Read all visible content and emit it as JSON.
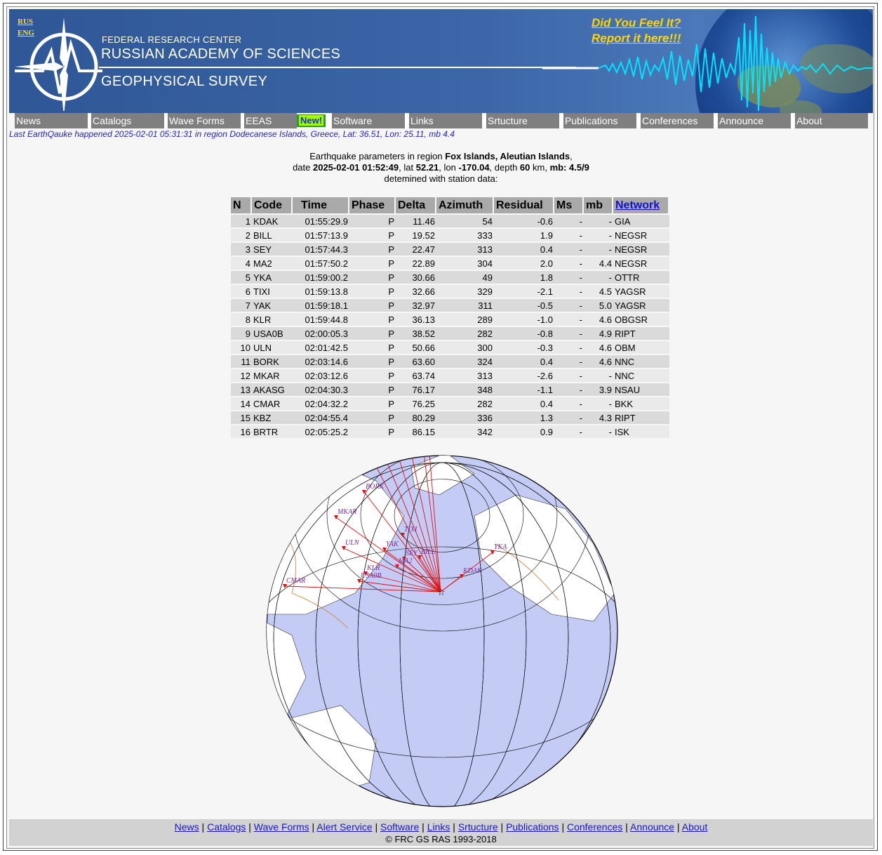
{
  "header": {
    "lang_rus": "RUS",
    "lang_eng": "ENG",
    "org_line1": "FEDERAL RESEARCH CENTER",
    "org_line2": "RUSSIAN ACADEMY OF SCIENCES",
    "org_line3": "GEOPHYSICAL SURVEY",
    "dyfi_line1": "Did You Feel It?",
    "dyfi_line2": "Report it here!!!"
  },
  "nav": {
    "items": [
      "News",
      "Catalogs",
      "Wave Forms",
      "EEAS",
      "Software",
      "Links",
      "Srtucture",
      "Publications",
      "Conferences",
      "Announce",
      "About"
    ],
    "new_badge": "New!"
  },
  "last_quake": "Last EarthQauke happened 2025-02-01 05:31:31 in region Dodecanese Islands, Greece, Lat: 36.51, Lon: 25.11, mb 4.4",
  "event": {
    "line1_prefix": "Earthquake parameters in region ",
    "region": "Fox Islands, Aleutian Islands",
    "line1_suffix": ",",
    "date_label": "date ",
    "date": "2025-02-01 01:52:49",
    "lat_label": ", lat ",
    "lat": "52.21",
    "lon_label": ", lon ",
    "lon": "-170.04",
    "depth_label": ", depth ",
    "depth": "60",
    "km_label": " km, ",
    "mb_label": "mb: 4.5/9",
    "line3": "detemined with station data:"
  },
  "table": {
    "headers": [
      "N",
      "Code",
      "Time",
      "Phase",
      "Delta",
      "Azimuth",
      "Residual",
      "Ms",
      "mb",
      "Network"
    ],
    "rows": [
      [
        "1",
        "KDAK",
        "01:55:29.9",
        "P",
        "11.46",
        "54",
        "-0.6",
        "-",
        "-",
        "GIA"
      ],
      [
        "2",
        "BILL",
        "01:57:13.9",
        "P",
        "19.52",
        "333",
        "1.9",
        "-",
        "-",
        "NEGSR"
      ],
      [
        "3",
        "SEY",
        "01:57:44.3",
        "P",
        "22.47",
        "313",
        "0.4",
        "-",
        "-",
        "NEGSR"
      ],
      [
        "4",
        "MA2",
        "01:57:50.2",
        "P",
        "22.89",
        "304",
        "2.0",
        "-",
        "4.4",
        "NEGSR"
      ],
      [
        "5",
        "YKA",
        "01:59:00.2",
        "P",
        "30.66",
        "49",
        "1.8",
        "-",
        "-",
        "OTTR"
      ],
      [
        "6",
        "TIXI",
        "01:59:13.8",
        "P",
        "32.66",
        "329",
        "-2.1",
        "-",
        "4.5",
        "YAGSR"
      ],
      [
        "7",
        "YAK",
        "01:59:18.1",
        "P",
        "32.97",
        "311",
        "-0.5",
        "-",
        "5.0",
        "YAGSR"
      ],
      [
        "8",
        "KLR",
        "01:59:44.8",
        "P",
        "36.13",
        "289",
        "-1.0",
        "-",
        "4.6",
        "OBGSR"
      ],
      [
        "9",
        "USA0B",
        "02:00:05.3",
        "P",
        "38.52",
        "282",
        "-0.8",
        "-",
        "4.9",
        "RIPT"
      ],
      [
        "10",
        "ULN",
        "02:01:42.5",
        "P",
        "50.66",
        "300",
        "-0.3",
        "-",
        "4.6",
        "OBM"
      ],
      [
        "11",
        "BORK",
        "02:03:14.6",
        "P",
        "63.60",
        "324",
        "0.4",
        "-",
        "4.6",
        "NNC"
      ],
      [
        "12",
        "MKAR",
        "02:03:12.6",
        "P",
        "63.74",
        "313",
        "-2.6",
        "-",
        "-",
        "NNC"
      ],
      [
        "13",
        "AKASG",
        "02:04:30.3",
        "P",
        "76.17",
        "348",
        "-1.1",
        "-",
        "3.9",
        "NSAU"
      ],
      [
        "14",
        "CMAR",
        "02:04:32.2",
        "P",
        "76.25",
        "282",
        "0.4",
        "-",
        "-",
        "BKK"
      ],
      [
        "15",
        "KBZ",
        "02:04:55.4",
        "P",
        "80.29",
        "336",
        "1.3",
        "-",
        "4.3",
        "RIPT"
      ],
      [
        "16",
        "BRTR",
        "02:05:25.2",
        "P",
        "86.15",
        "342",
        "0.9",
        "-",
        "-",
        "ISK"
      ]
    ]
  },
  "map": {
    "station_labels": [
      "BORK",
      "MKAR",
      "ULN",
      "YAK",
      "TIXI",
      "BILL",
      "SEY",
      "MA2",
      "KLR",
      "USA0B",
      "CMAR",
      "KDAK",
      "YKA"
    ],
    "colors": {
      "ocean": "#c4ccf6",
      "land": "#ffffff",
      "ray": "#e01010",
      "label": "#7a2aa0",
      "border": "#d07a30",
      "grid": "#000000"
    }
  },
  "footer": {
    "links": [
      "News",
      "Catalogs",
      "Wave Forms",
      "Alert Service",
      "Software",
      "Links",
      "Srtucture",
      "Publications",
      "Conferences",
      "Announce",
      "About"
    ],
    "copyright": "© FRC GS RAS 1993-2018"
  }
}
